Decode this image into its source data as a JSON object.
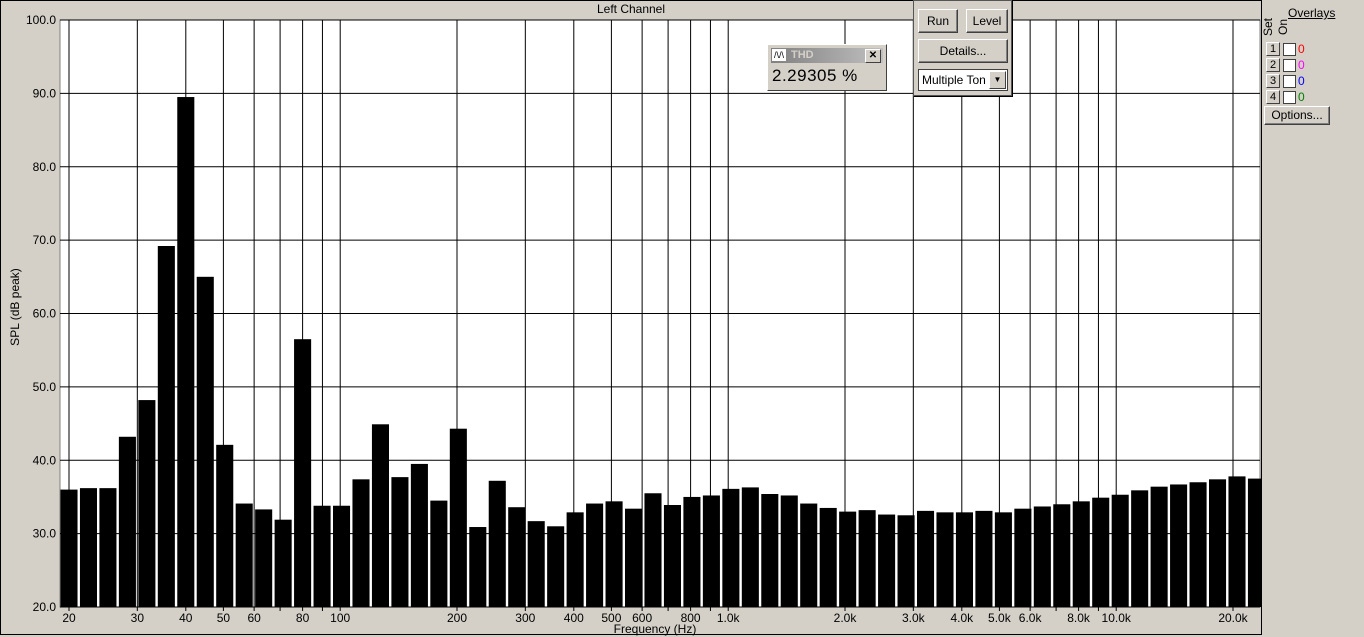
{
  "chart_data": {
    "type": "bar",
    "title": "Left Channel",
    "xlabel": "Frequency (Hz)",
    "ylabel": "SPL (dB peak)",
    "xscale": "log",
    "xlim": [
      19,
      23400
    ],
    "ylim": [
      20,
      100
    ],
    "grid": true,
    "bar_spacing": "1/6 octave",
    "x_tick_labels": [
      {
        "f": 20,
        "label": "20"
      },
      {
        "f": 30,
        "label": "30"
      },
      {
        "f": 40,
        "label": "40"
      },
      {
        "f": 50,
        "label": "50"
      },
      {
        "f": 60,
        "label": "60"
      },
      {
        "f": 80,
        "label": "80"
      },
      {
        "f": 100,
        "label": "100"
      },
      {
        "f": 200,
        "label": "200"
      },
      {
        "f": 300,
        "label": "300"
      },
      {
        "f": 400,
        "label": "400"
      },
      {
        "f": 500,
        "label": "500"
      },
      {
        "f": 600,
        "label": "600"
      },
      {
        "f": 800,
        "label": "800"
      },
      {
        "f": 1000,
        "label": "1.0k"
      },
      {
        "f": 2000,
        "label": "2.0k"
      },
      {
        "f": 3000,
        "label": "3.0k"
      },
      {
        "f": 4000,
        "label": "4.0k"
      },
      {
        "f": 5000,
        "label": "5.0k"
      },
      {
        "f": 6000,
        "label": "6.0k"
      },
      {
        "f": 8000,
        "label": "8.0k"
      },
      {
        "f": 10000,
        "label": "10.0k"
      },
      {
        "f": 20000,
        "label": "20.0k"
      }
    ],
    "y_tick_labels": [
      "20.0",
      "30.0",
      "40.0",
      "50.0",
      "60.0",
      "70.0",
      "80.0",
      "90.0",
      "100.0"
    ],
    "start_frequency": 20,
    "values": [
      36.0,
      36.2,
      36.2,
      43.2,
      48.2,
      69.2,
      89.5,
      65.0,
      42.1,
      34.1,
      33.3,
      31.9,
      56.5,
      33.8,
      33.8,
      37.4,
      44.9,
      37.7,
      39.5,
      34.5,
      44.3,
      30.9,
      37.2,
      33.6,
      31.7,
      31.0,
      32.9,
      34.1,
      34.4,
      33.4,
      35.5,
      33.9,
      35.0,
      35.2,
      36.1,
      36.3,
      35.4,
      35.2,
      34.1,
      33.5,
      33.0,
      33.2,
      32.6,
      32.5,
      33.1,
      32.9,
      32.9,
      33.1,
      32.9,
      33.4,
      33.7,
      34.0,
      34.4,
      34.9,
      35.3,
      35.9,
      36.4,
      36.7,
      37.0,
      37.4,
      37.8,
      37.5
    ],
    "bar_color": "#000000"
  },
  "toolbar": {
    "run": "Run",
    "level": "Level",
    "details": "Details...",
    "mode": "Multiple Ton"
  },
  "thd": {
    "title": "THD",
    "value": "2.29305 %"
  },
  "overlays": {
    "title": "Overlays",
    "set": "Set",
    "on": "On",
    "options": "Options...",
    "rows": [
      {
        "n": "1",
        "count": "0",
        "color": "#ff0000"
      },
      {
        "n": "2",
        "count": "0",
        "color": "#ff00ff"
      },
      {
        "n": "3",
        "count": "0",
        "color": "#0000ff"
      },
      {
        "n": "4",
        "count": "0",
        "color": "#008000"
      }
    ]
  }
}
